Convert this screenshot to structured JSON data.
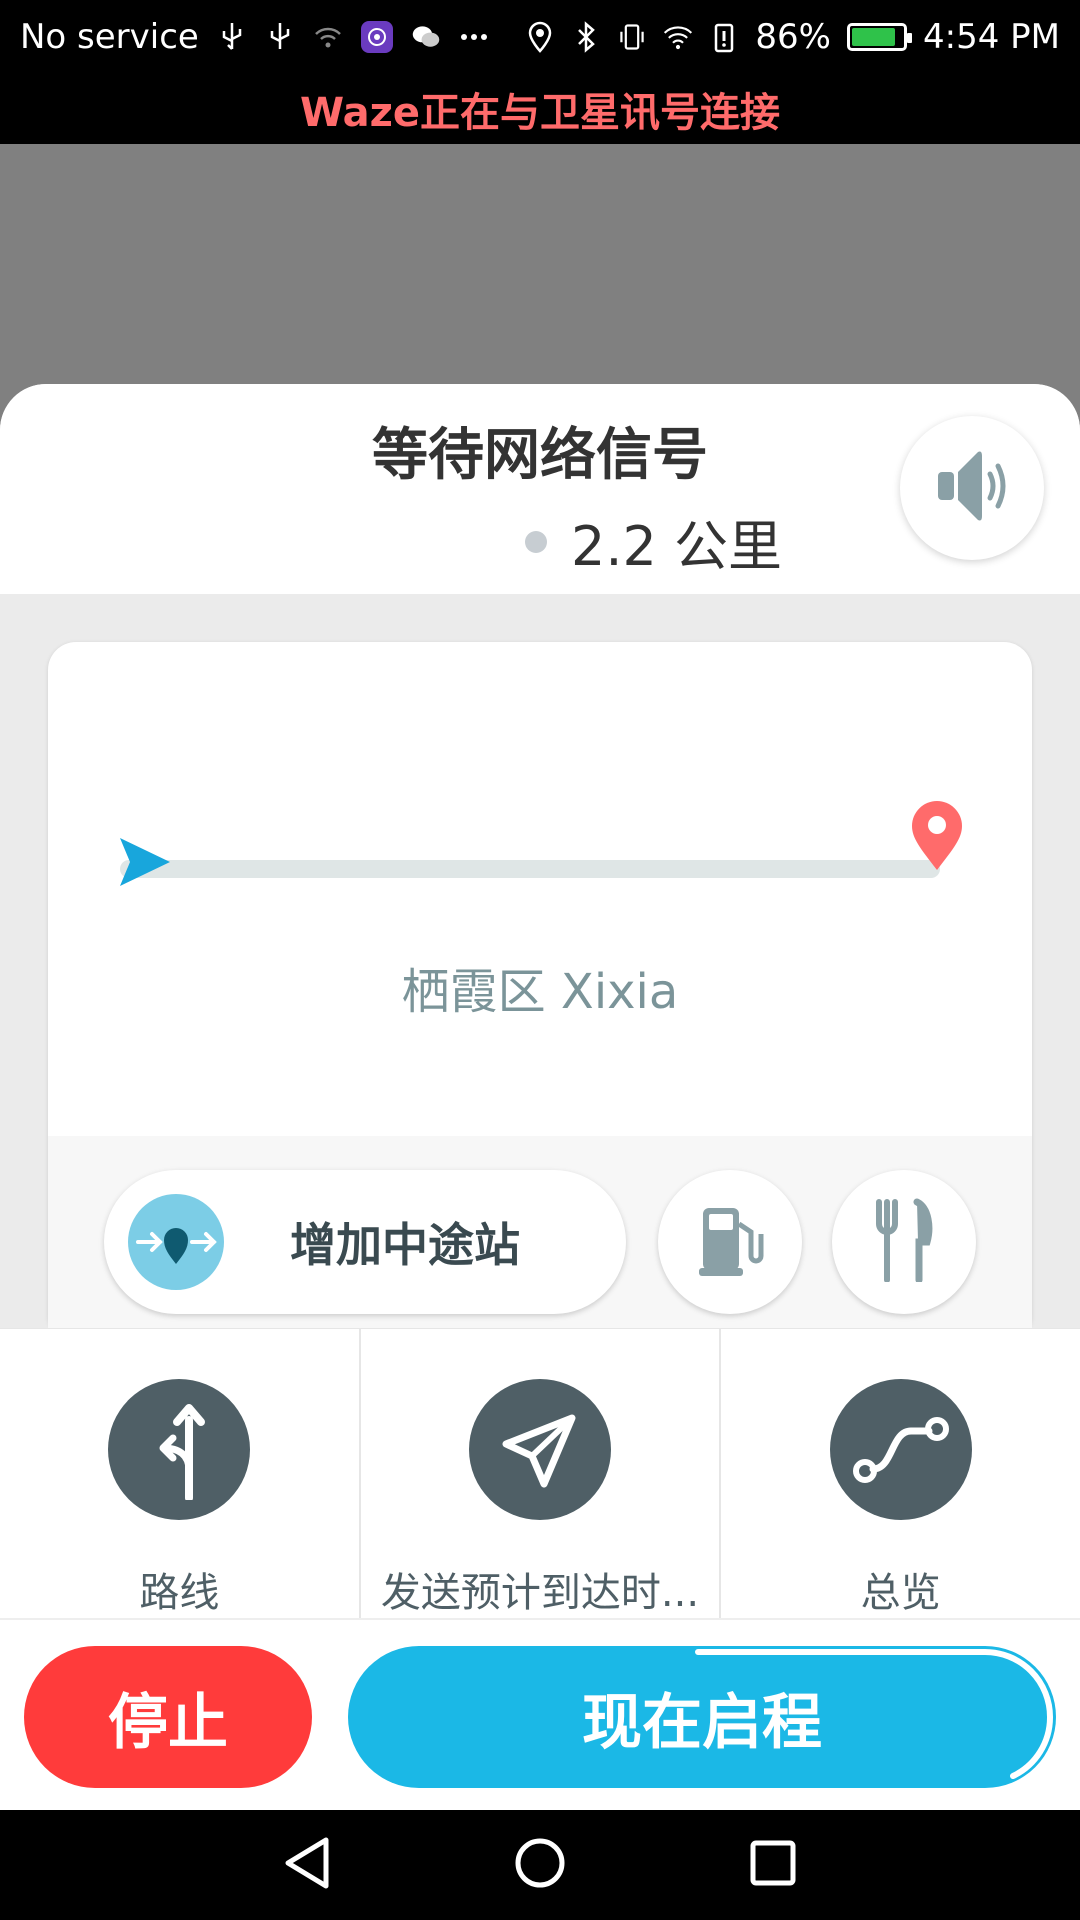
{
  "status_bar": {
    "carrier": "No service",
    "battery": "86%",
    "time": "4:54 PM"
  },
  "banner": {
    "text": "Waze正在与卫星讯号连接"
  },
  "route": {
    "title": "等待网络信号",
    "distance": "2.2 公里",
    "destination": "栖霞区 Xixia"
  },
  "card_actions": {
    "add_stop_label": "增加中途站",
    "gas_icon": "gas-station-icon",
    "food_icon": "restaurant-icon"
  },
  "options": [
    {
      "label": "路线",
      "icon": "routes-icon"
    },
    {
      "label": "发送预计到达时...",
      "icon": "send-eta-icon"
    },
    {
      "label": "总览",
      "icon": "overview-icon"
    }
  ],
  "buttons": {
    "stop": "停止",
    "go": "现在启程"
  },
  "colors": {
    "banner_text": "#ff6b6b",
    "stop": "#ff3b3b",
    "go": "#1bb8e6",
    "start_marker": "#18a6dc",
    "destination_marker": "#ff6b6b"
  }
}
